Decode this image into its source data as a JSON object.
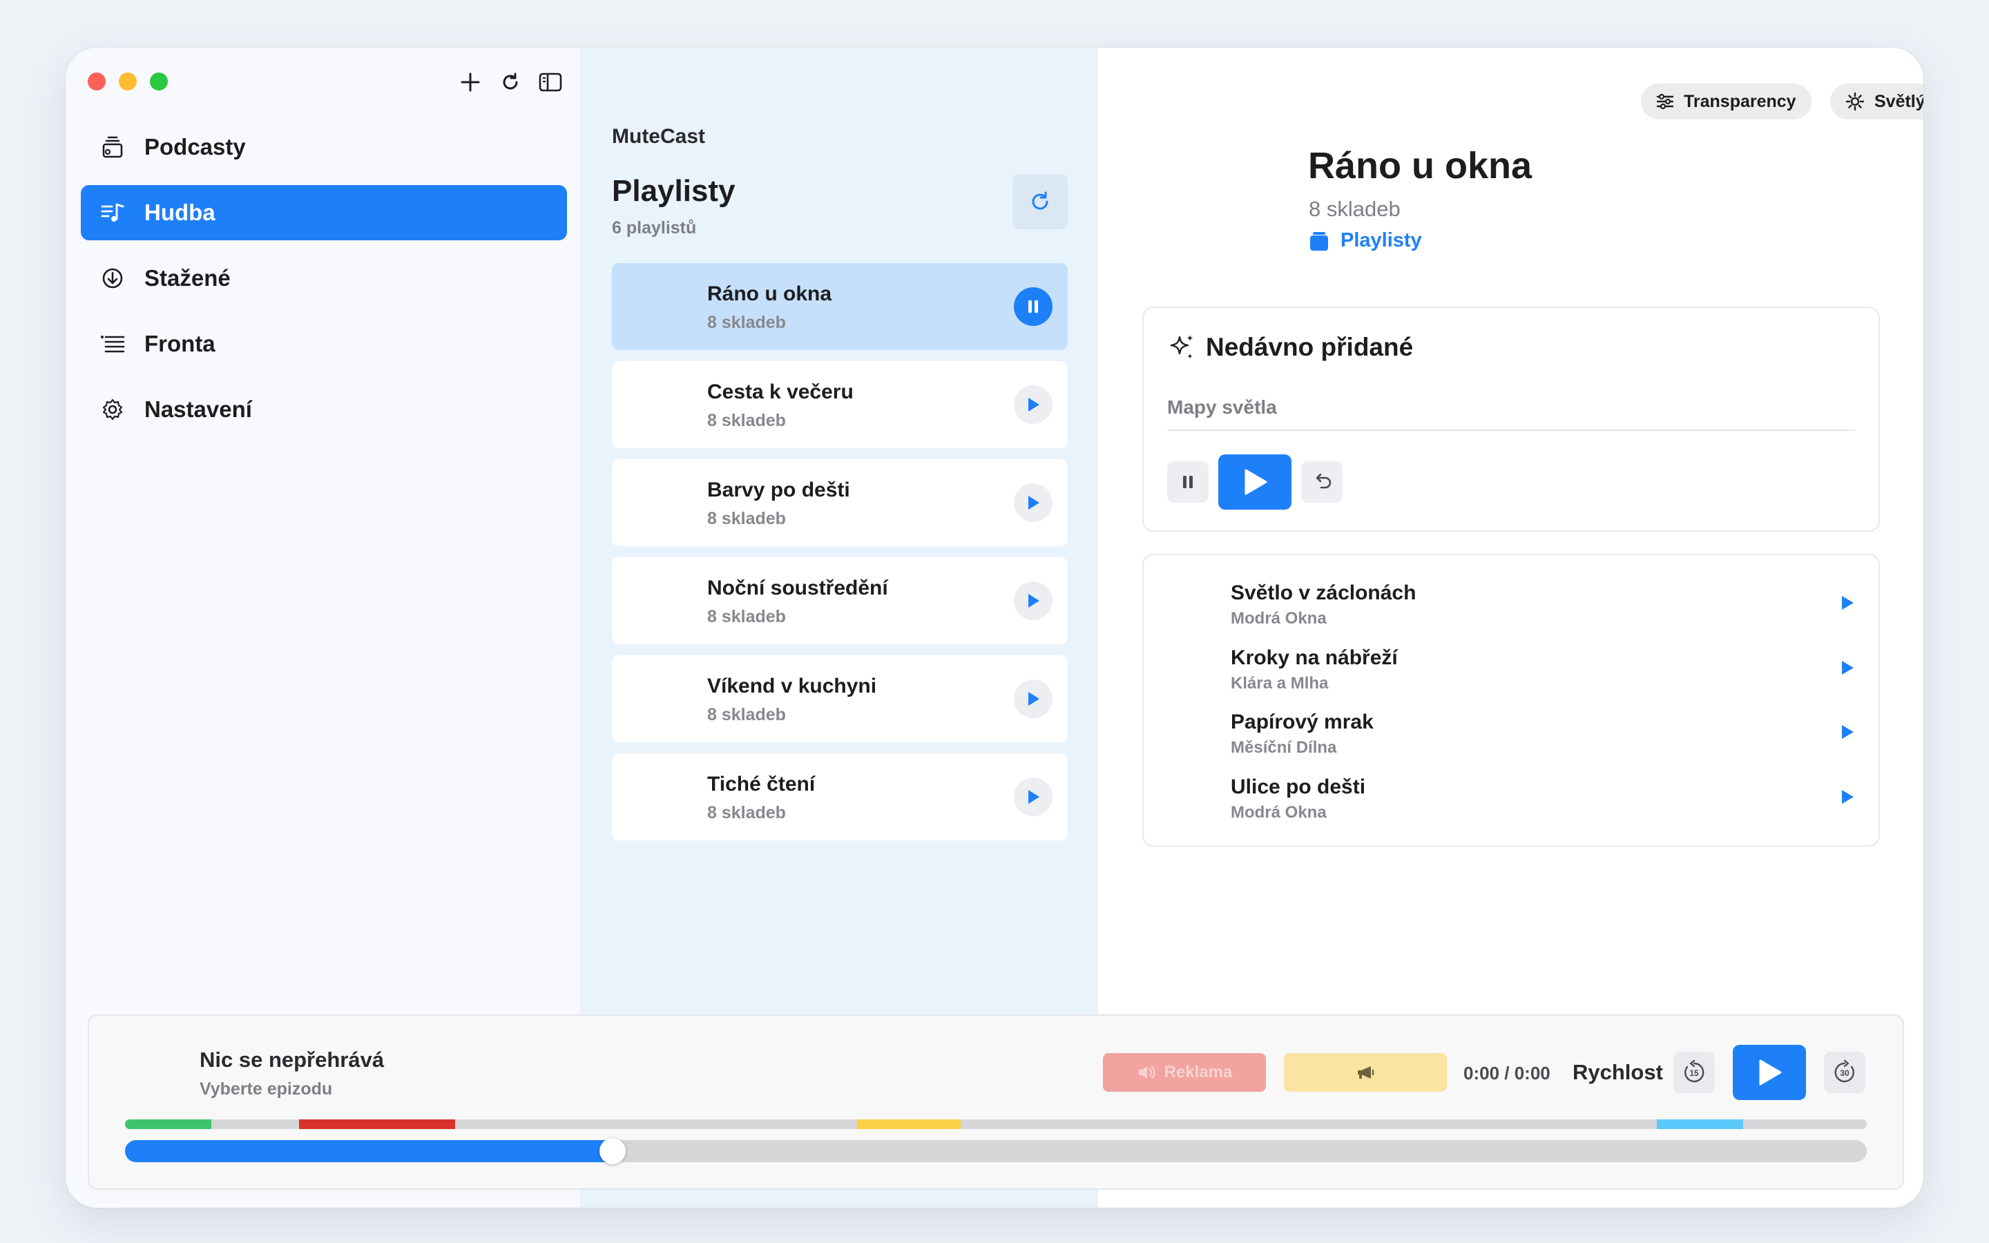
{
  "sidebar": {
    "items": [
      {
        "label": "Podcasty",
        "icon": "podcast-stack-icon"
      },
      {
        "label": "Hudba",
        "icon": "music-list-icon",
        "active": true
      },
      {
        "label": "Stažené",
        "icon": "download-circle-icon"
      },
      {
        "label": "Fronta",
        "icon": "queue-list-icon"
      },
      {
        "label": "Nastavení",
        "icon": "gear-icon"
      }
    ]
  },
  "middle": {
    "app_name": "MuteCast",
    "title": "Playlisty",
    "count": "6 playlistů",
    "playlists": [
      {
        "title": "Ráno u okna",
        "sub": "8 skladeb",
        "active": true
      },
      {
        "title": "Cesta k večeru",
        "sub": "8 skladeb"
      },
      {
        "title": "Barvy po dešti",
        "sub": "8 skladeb"
      },
      {
        "title": "Noční soustředění",
        "sub": "8 skladeb"
      },
      {
        "title": "Víkend v kuchyni",
        "sub": "8 skladeb"
      },
      {
        "title": "Tiché čtení",
        "sub": "8 skladeb"
      }
    ]
  },
  "detail": {
    "transparency_label": "Transparency",
    "theme_label": "Světlý",
    "title": "Ráno u okna",
    "sub": "8 skladeb",
    "link": "Playlisty",
    "recent": {
      "heading": "Nedávno přidané",
      "track": "Mapy světla"
    },
    "tracks": [
      {
        "title": "Světlo v záclonách",
        "artist": "Modrá Okna"
      },
      {
        "title": "Kroky na nábřeží",
        "artist": "Klára a Mlha"
      },
      {
        "title": "Papírový mrak",
        "artist": "Měsíční Dílna"
      },
      {
        "title": "Ulice po dešti",
        "artist": "Modrá Okna"
      }
    ]
  },
  "player": {
    "title": "Nic se nepřehrává",
    "sub": "Vyberte epizodu",
    "ad_label": "Reklama",
    "time": "0:00 / 0:00",
    "speed_label": "Rychlost",
    "skip_back": "15",
    "skip_forward": "30",
    "progress": 0.28
  },
  "colors": {
    "accent": "#1e80f8",
    "chapter_green": "#3cc46a",
    "chapter_red": "#d9322b",
    "chapter_yellow": "#fbd146",
    "chapter_cyan": "#5ac8fa"
  }
}
